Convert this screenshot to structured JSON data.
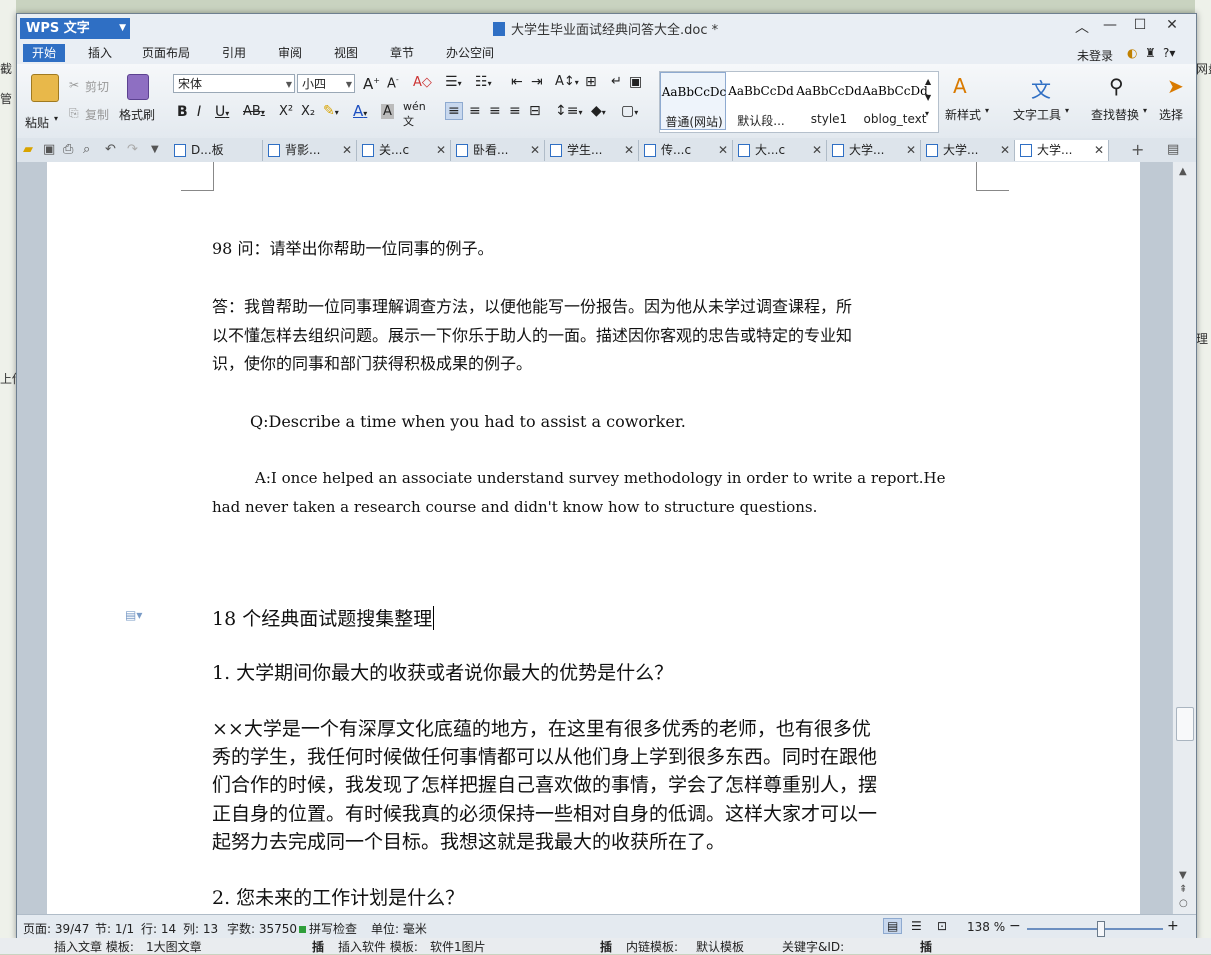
{
  "window": {
    "app_name": "WPS 文字",
    "doc_title": "大学生毕业面试经典问答大全.doc *",
    "login": "未登录"
  },
  "menu": [
    "开始",
    "插入",
    "页面布局",
    "引用",
    "审阅",
    "视图",
    "章节",
    "办公空间"
  ],
  "ribbon": {
    "paste": "粘贴",
    "cut": "剪切",
    "copy": "复制",
    "format_painter": "格式刷",
    "font_name": "宋体",
    "font_size": "小四",
    "styles": [
      {
        "preview": "AaBbCcDc",
        "name": "普通(网站)"
      },
      {
        "preview": "AaBbCcDd",
        "name": "默认段..."
      },
      {
        "preview": "AaBbCcDd",
        "name": "style1"
      },
      {
        "preview": "AaBbCcDd",
        "name": "oblog_text"
      }
    ],
    "new_style": "新样式",
    "text_tools": "文字工具",
    "find_replace": "查找替换",
    "select": "选择"
  },
  "tabs": [
    {
      "label": "D...板"
    },
    {
      "label": "背影..."
    },
    {
      "label": "关...c"
    },
    {
      "label": "卧看..."
    },
    {
      "label": "学生..."
    },
    {
      "label": "传...c"
    },
    {
      "label": "大...c"
    },
    {
      "label": "大学..."
    },
    {
      "label": "大学..."
    },
    {
      "label": "大学..."
    }
  ],
  "document": {
    "q98": "98 问：请举出你帮助一位同事的例子。",
    "a98_lines": [
      "答：我曾帮助一位同事理解调查方法，以便他能写一份报告。因为他从未学过调查课程，所",
      "以不懂怎样去组织问题。展示一下你乐于助人的一面。描述因你客观的忠告或特定的专业知",
      "识，使你的同事和部门获得积极成果的例子。"
    ],
    "q_en": "Q:Describe a time when you had to assist a coworker.",
    "a_en_lines": [
      "A:I once helped an associate understand survey methodology in order to write a report.He",
      "had never taken a research course and didn't know how to structure questions."
    ],
    "heading": "18 个经典面试题搜集整理",
    "q1": "1. 大学期间你最大的收获或者说你最大的优势是什么？",
    "a1_lines": [
      "××大学是一个有深厚文化底蕴的地方，在这里有很多优秀的老师，也有很多优",
      "秀的学生，我任何时候做任何事情都可以从他们身上学到很多东西。同时在跟他",
      "们合作的时候，我发现了怎样把握自己喜欢做的事情，学会了怎样尊重别人，摆",
      "正自身的位置。有时候我真的必须保持一些相对自身的低调。这样大家才可以一",
      "起努力去完成同一个目标。我想这就是我最大的收获所在了。"
    ],
    "q2": "2. 您未来的工作计划是什么？"
  },
  "status": {
    "page": "页面: 39/47",
    "section": "节: 1/1",
    "row": "行: 14",
    "col": "列: 13",
    "words": "字数: 35750",
    "spell": "拼写检查",
    "unit": "单位: 毫米",
    "zoom": "138 %"
  },
  "background": {
    "left_bits": [
      "截",
      "管",
      "上传"
    ],
    "right_bits": [
      "网盘",
      "理"
    ],
    "bottom": [
      "插入文章 模板:",
      "1大图文章",
      "插",
      "插入软件 模板:",
      "软件1图片",
      "插",
      "内链模板:",
      "默认模板",
      "关键字&ID:",
      "插"
    ]
  }
}
